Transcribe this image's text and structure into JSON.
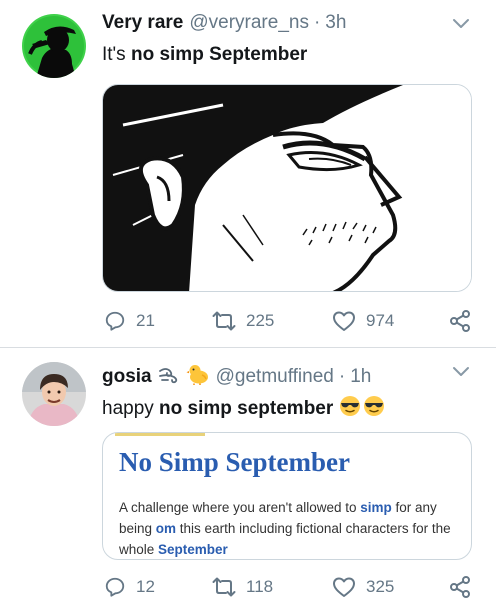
{
  "tweets": [
    {
      "author_name": "Very rare",
      "handle": "@veryrare_ns",
      "separator": "·",
      "time": "3h",
      "text_prefix": "It's ",
      "text_bold": "no simp September",
      "text_suffix": "",
      "media": "manga-face-closeup",
      "counts": {
        "replies": "21",
        "retweets": "225",
        "likes": "974"
      }
    },
    {
      "author_name": "gosia",
      "name_emojis": [
        "wind-swirl-icon",
        "baby-chick-icon"
      ],
      "handle": "@getmuffined",
      "separator": "·",
      "time": "1h",
      "text_prefix": "happy ",
      "text_bold": "no simp september",
      "text_suffix": "",
      "text_emojis": [
        "sunglasses-face-icon",
        "sunglasses-face-icon"
      ],
      "card": {
        "title": "No Simp September",
        "desc_part1": "A challenge where you aren't allowed to ",
        "desc_hl1": "simp",
        "desc_part2": " for any being ",
        "desc_hl2": "om",
        "desc_part3": " this earth including fictional characters for the whole ",
        "desc_hl3": "September"
      },
      "counts": {
        "replies": "12",
        "retweets": "118",
        "likes": "325"
      }
    }
  ],
  "colors": {
    "text": "#14171a",
    "secondary": "#657786",
    "border": "#ccd6dd",
    "card_title": "#2a5db0",
    "avatar1_green": "#3fd14a",
    "avatar2_bg": "#e9b8c6"
  }
}
